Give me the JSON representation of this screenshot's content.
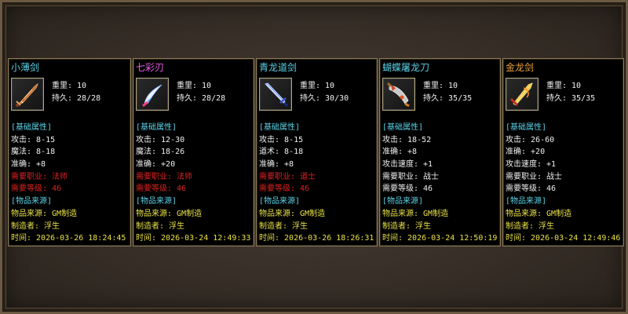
{
  "cards": [
    {
      "name": "小薄剑",
      "name_color": "#5ad1e6",
      "icon": "sword-orange-icon",
      "weight": "重里: 10",
      "durability": "持久: 28/28",
      "lines": [
        {
          "text": "[基础属性]",
          "color": "c-cyan"
        },
        {
          "text": "攻击: 8-15",
          "color": "c-white"
        },
        {
          "text": "魔法: 8-18",
          "color": "c-white"
        },
        {
          "text": "准确: +8",
          "color": "c-white"
        },
        {
          "text": "需要职业: 法师",
          "color": "c-red"
        },
        {
          "text": "需要等级: 46",
          "color": "c-red"
        },
        {
          "text": "[物品来源]",
          "color": "c-cyan"
        },
        {
          "text": "物品来源: GM制造",
          "color": "c-yellow"
        },
        {
          "text": "制造者: 浮生",
          "color": "c-yellow"
        },
        {
          "text": "时间: 2026-03-26 18:24:45",
          "color": "c-yellow"
        }
      ]
    },
    {
      "name": "七彩刃",
      "name_color": "#e85ae8",
      "icon": "crescent-blade-icon",
      "weight": "重里: 10",
      "durability": "持久: 28/28",
      "lines": [
        {
          "text": "[基础属性]",
          "color": "c-cyan"
        },
        {
          "text": "攻击: 12-30",
          "color": "c-white"
        },
        {
          "text": "魔法: 18-26",
          "color": "c-white"
        },
        {
          "text": "准确: +20",
          "color": "c-white"
        },
        {
          "text": "需要职业: 法师",
          "color": "c-red"
        },
        {
          "text": "需要等级: 46",
          "color": "c-red"
        },
        {
          "text": "[物品来源]",
          "color": "c-cyan"
        },
        {
          "text": "物品来源: GM制造",
          "color": "c-yellow"
        },
        {
          "text": "制造者: 浮生",
          "color": "c-yellow"
        },
        {
          "text": "时间: 2026-03-24 12:49:33",
          "color": "c-yellow"
        }
      ]
    },
    {
      "name": "青龙道剑",
      "name_color": "#5ad1e6",
      "icon": "blue-sword-icon",
      "weight": "重里: 10",
      "durability": "持久: 30/30",
      "lines": [
        {
          "text": "[基础属性]",
          "color": "c-cyan"
        },
        {
          "text": "攻击: 8-15",
          "color": "c-white"
        },
        {
          "text": "道术: 8-18",
          "color": "c-white"
        },
        {
          "text": "准确: +8",
          "color": "c-white"
        },
        {
          "text": "需要职业: 道士",
          "color": "c-red"
        },
        {
          "text": "需要等级: 46",
          "color": "c-red"
        },
        {
          "text": "[物品来源]",
          "color": "c-cyan"
        },
        {
          "text": "物品来源: GM制造",
          "color": "c-yellow"
        },
        {
          "text": "制造者: 浮生",
          "color": "c-yellow"
        },
        {
          "text": "时间: 2026-03-26 18:26:31",
          "color": "c-yellow"
        }
      ]
    },
    {
      "name": "蝴蝶屠龙刀",
      "name_color": "#5ad1e6",
      "icon": "butterfly-blade-icon",
      "weight": "重里: 10",
      "durability": "持久: 35/35",
      "lines": [
        {
          "text": "[基础属性]",
          "color": "c-cyan"
        },
        {
          "text": "攻击: 18-52",
          "color": "c-white"
        },
        {
          "text": "准确: +8",
          "color": "c-white"
        },
        {
          "text": "攻击速度: +1",
          "color": "c-white"
        },
        {
          "text": "需要职业: 战士",
          "color": "c-white"
        },
        {
          "text": "需要等级: 46",
          "color": "c-white"
        },
        {
          "text": "[物品来源]",
          "color": "c-cyan"
        },
        {
          "text": "物品来源: GM制造",
          "color": "c-yellow"
        },
        {
          "text": "制造者: 浮生",
          "color": "c-yellow"
        },
        {
          "text": "时间: 2026-03-24 12:50:19",
          "color": "c-yellow"
        }
      ]
    },
    {
      "name": "金龙剑",
      "name_color": "#e8a040",
      "icon": "golden-dragon-sword-icon",
      "weight": "重里: 10",
      "durability": "持久: 35/35",
      "lines": [
        {
          "text": "[基础属性]",
          "color": "c-cyan"
        },
        {
          "text": "攻击: 26-60",
          "color": "c-white"
        },
        {
          "text": "准确: +20",
          "color": "c-white"
        },
        {
          "text": "攻击速度: +1",
          "color": "c-white"
        },
        {
          "text": "需要职业: 战士",
          "color": "c-white"
        },
        {
          "text": "需要等级: 46",
          "color": "c-white"
        },
        {
          "text": "[物品来源]",
          "color": "c-cyan"
        },
        {
          "text": "物品来源: GM制造",
          "color": "c-yellow"
        },
        {
          "text": "制造者: 浮生",
          "color": "c-yellow"
        },
        {
          "text": "时间: 2026-03-24 12:49:46",
          "color": "c-yellow"
        }
      ]
    }
  ]
}
